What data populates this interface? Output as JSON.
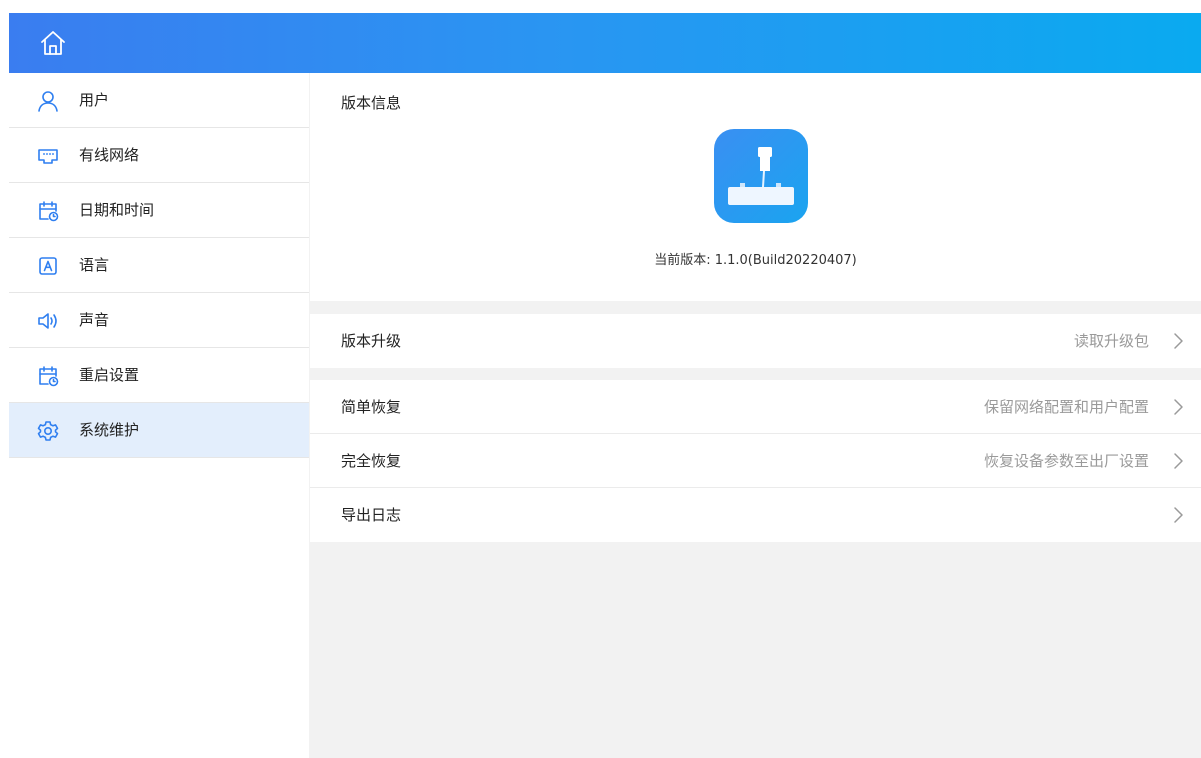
{
  "header": {
    "home_icon": "home-icon"
  },
  "sidebar": {
    "items": [
      {
        "label": "用户",
        "icon": "user-icon",
        "active": false
      },
      {
        "label": "有线网络",
        "icon": "ethernet-icon",
        "active": false
      },
      {
        "label": "日期和时间",
        "icon": "calendar-clock-icon",
        "active": false
      },
      {
        "label": "语言",
        "icon": "language-icon",
        "active": false
      },
      {
        "label": "声音",
        "icon": "speaker-icon",
        "active": false
      },
      {
        "label": "重启设置",
        "icon": "calendar-clock-icon",
        "active": false
      },
      {
        "label": "系统维护",
        "icon": "gear-icon",
        "active": true
      }
    ]
  },
  "main": {
    "version_section": {
      "title": "版本信息",
      "current_version": "当前版本: 1.1.0(Build20220407)"
    },
    "upgrade": {
      "label": "版本升级",
      "value": "读取升级包"
    },
    "actions": [
      {
        "label": "简单恢复",
        "value": "保留网络配置和用户配置"
      },
      {
        "label": "完全恢复",
        "value": "恢复设备参数至出厂设置"
      },
      {
        "label": "导出日志",
        "value": ""
      }
    ]
  },
  "colors": {
    "header_gradient_start": "#3a7df0",
    "header_gradient_end": "#0aaaf0",
    "accent_icon": "#2f7ff0",
    "active_item_bg": "#e3eefc",
    "muted_text": "#9a9a9a"
  }
}
